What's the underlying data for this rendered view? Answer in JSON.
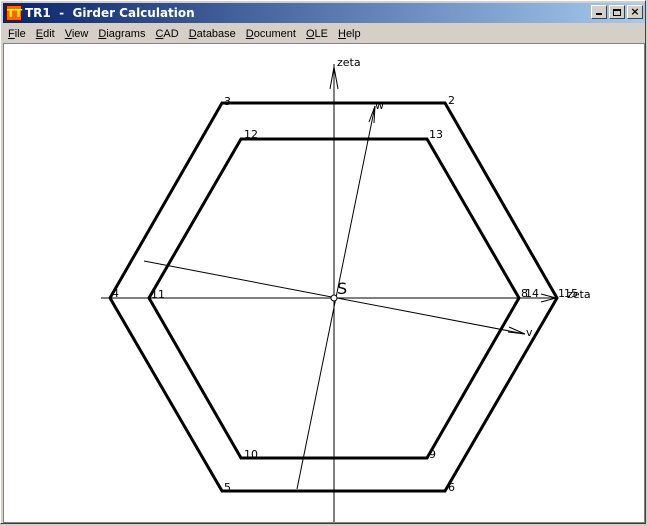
{
  "window": {
    "icon_text": "TT",
    "title": "TR1  -  Girder Calculation",
    "buttons": {
      "minimize": "_",
      "maximize": "□",
      "close": "×"
    }
  },
  "menu": [
    {
      "label": "File",
      "accel": "F",
      "rest": "ile"
    },
    {
      "label": "Edit",
      "accel": "E",
      "rest": "dit"
    },
    {
      "label": "View",
      "accel": "V",
      "rest": "iew"
    },
    {
      "label": "Diagrams",
      "accel": "D",
      "rest": "iagrams"
    },
    {
      "label": "CAD",
      "accel": "C",
      "rest": "AD"
    },
    {
      "label": "Database",
      "accel": "D",
      "rest": "atabase"
    },
    {
      "label": "Document",
      "accel": "D",
      "rest": "ocument"
    },
    {
      "label": "OLE",
      "accel": "O",
      "rest": "LE"
    },
    {
      "label": "Help",
      "accel": "H",
      "rest": "elp"
    }
  ],
  "drawing": {
    "axis_zeta_label": "zeta",
    "axis_eta_label": "zeta",
    "axis_w_label": "w",
    "axis_v_label": "v",
    "centroid_label": "S",
    "outer_nodes": [
      "1",
      "2",
      "3",
      "4",
      "5",
      "6"
    ],
    "inner_nodes": [
      "9",
      "10",
      "11",
      "12",
      "13",
      "14"
    ],
    "node_8_label": "8",
    "node_1_overlap_label": "15"
  }
}
